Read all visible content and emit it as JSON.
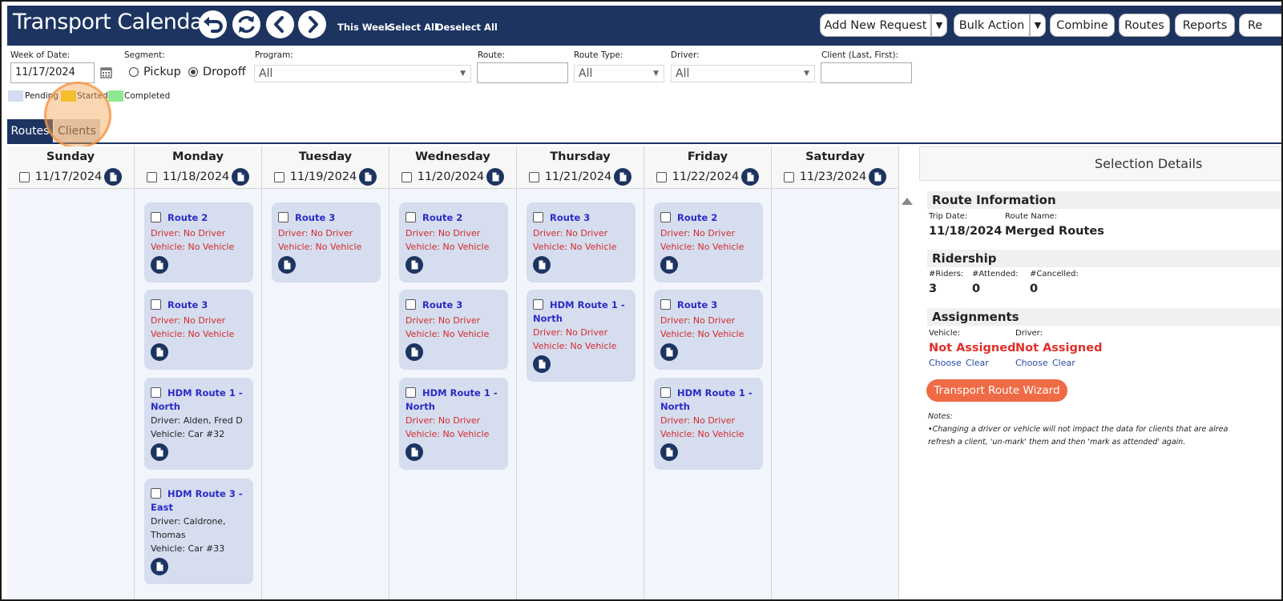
{
  "header": {
    "title": "Transport Calendar",
    "links": {
      "this_week": "This Week",
      "select_all": "Select All",
      "deselect_all": "Deselect All"
    },
    "buttons": {
      "add_new_request": "Add New Request",
      "bulk_action": "Bulk Action",
      "combine": "Combine",
      "routes": "Routes",
      "reports": "Reports",
      "re_partial": "Re"
    },
    "icons": [
      "undo-icon",
      "refresh-icon",
      "chevron-left-icon",
      "chevron-right-icon"
    ]
  },
  "filters": {
    "week_of_date": {
      "label": "Week of Date:",
      "value": "11/17/2024"
    },
    "segment": {
      "label": "Segment:",
      "options": [
        "Pickup",
        "Dropoff"
      ],
      "selected": "Dropoff"
    },
    "program": {
      "label": "Program:",
      "value": "All"
    },
    "route": {
      "label": "Route:",
      "value": ""
    },
    "route_type": {
      "label": "Route Type:",
      "value": "All"
    },
    "driver": {
      "label": "Driver:",
      "value": "All"
    },
    "client": {
      "label": "Client (Last, First):",
      "value": ""
    }
  },
  "legend": [
    {
      "label": "Pending",
      "color": "#d4dcef"
    },
    {
      "label": "Started",
      "color": "#f5d40f"
    },
    {
      "label": "Completed",
      "color": "#8fe88f"
    }
  ],
  "tabs": {
    "routes": "Routes",
    "clients": "Clients"
  },
  "days": [
    {
      "name": "Sunday",
      "date": "11/17/2024",
      "cards": []
    },
    {
      "name": "Monday",
      "date": "11/18/2024",
      "cards": [
        {
          "title": "Route 2",
          "driver": "Driver: No Driver",
          "vehicle": "Vehicle: No Vehicle"
        },
        {
          "title": "Route 3",
          "driver": "Driver: No Driver",
          "vehicle": "Vehicle: No Vehicle"
        },
        {
          "title": "HDM Route 1 -",
          "title2": "North",
          "driver": "Driver: Alden, Fred D",
          "vehicle": "Vehicle: Car #32"
        },
        {
          "title": "HDM Route 3 -",
          "title2": "East",
          "driver": "Driver: Caldrone,",
          "driver2": "Thomas",
          "vehicle": "Vehicle: Car #33"
        }
      ]
    },
    {
      "name": "Tuesday",
      "date": "11/19/2024",
      "cards": [
        {
          "title": "Route 3",
          "driver": "Driver: No Driver",
          "vehicle": "Vehicle: No Vehicle"
        }
      ]
    },
    {
      "name": "Wednesday",
      "date": "11/20/2024",
      "cards": [
        {
          "title": "Route 2",
          "driver": "Driver: No Driver",
          "vehicle": "Vehicle: No Vehicle"
        },
        {
          "title": "Route 3",
          "driver": "Driver: No Driver",
          "vehicle": "Vehicle: No Vehicle"
        },
        {
          "title": "HDM Route 1 -",
          "title2": "North",
          "driver": "Driver: No Driver",
          "vehicle": "Vehicle: No Vehicle"
        }
      ]
    },
    {
      "name": "Thursday",
      "date": "11/21/2024",
      "cards": [
        {
          "title": "Route 3",
          "driver": "Driver: No Driver",
          "vehicle": "Vehicle: No Vehicle"
        },
        {
          "title": "HDM Route 1 -",
          "title2": "North",
          "driver": "Driver: No Driver",
          "vehicle": "Vehicle: No Vehicle"
        }
      ]
    },
    {
      "name": "Friday",
      "date": "11/22/2024",
      "cards": [
        {
          "title": "Route 2",
          "driver": "Driver: No Driver",
          "vehicle": "Vehicle: No Vehicle"
        },
        {
          "title": "Route 3",
          "driver": "Driver: No Driver",
          "vehicle": "Vehicle: No Vehicle"
        },
        {
          "title": "HDM Route 1 -",
          "title2": "North",
          "driver": "Driver: No Driver",
          "vehicle": "Vehicle: No Vehicle"
        }
      ]
    },
    {
      "name": "Saturday",
      "date": "11/23/2024",
      "cards": []
    }
  ],
  "details": {
    "heading": "Selection Details",
    "route_info": {
      "title": "Route Information",
      "trip_date_label": "Trip Date:",
      "trip_date": "11/18/2024",
      "route_name_label": "Route Name:",
      "route_name": "Merged Routes"
    },
    "ridership": {
      "title": "Ridership",
      "riders_label": "#Riders:",
      "riders": "3",
      "attended_label": "#Attended:",
      "attended": "0",
      "cancelled_label": "#Cancelled:",
      "cancelled": "0"
    },
    "assignments": {
      "title": "Assignments",
      "vehicle_label": "Vehicle:",
      "vehicle_value": "Not Assigned",
      "driver_label": "Driver:",
      "driver_value": "Not Assigned",
      "choose": "Choose",
      "clear": "Clear"
    },
    "wizard_button": "Transport Route Wizard",
    "notes_label": "Notes:",
    "notes_line1": "•Changing a driver or vehicle will not impact the data for clients that are alrea",
    "notes_line2": "refresh a client, 'un-mark' them and then 'mark as attended' again."
  }
}
